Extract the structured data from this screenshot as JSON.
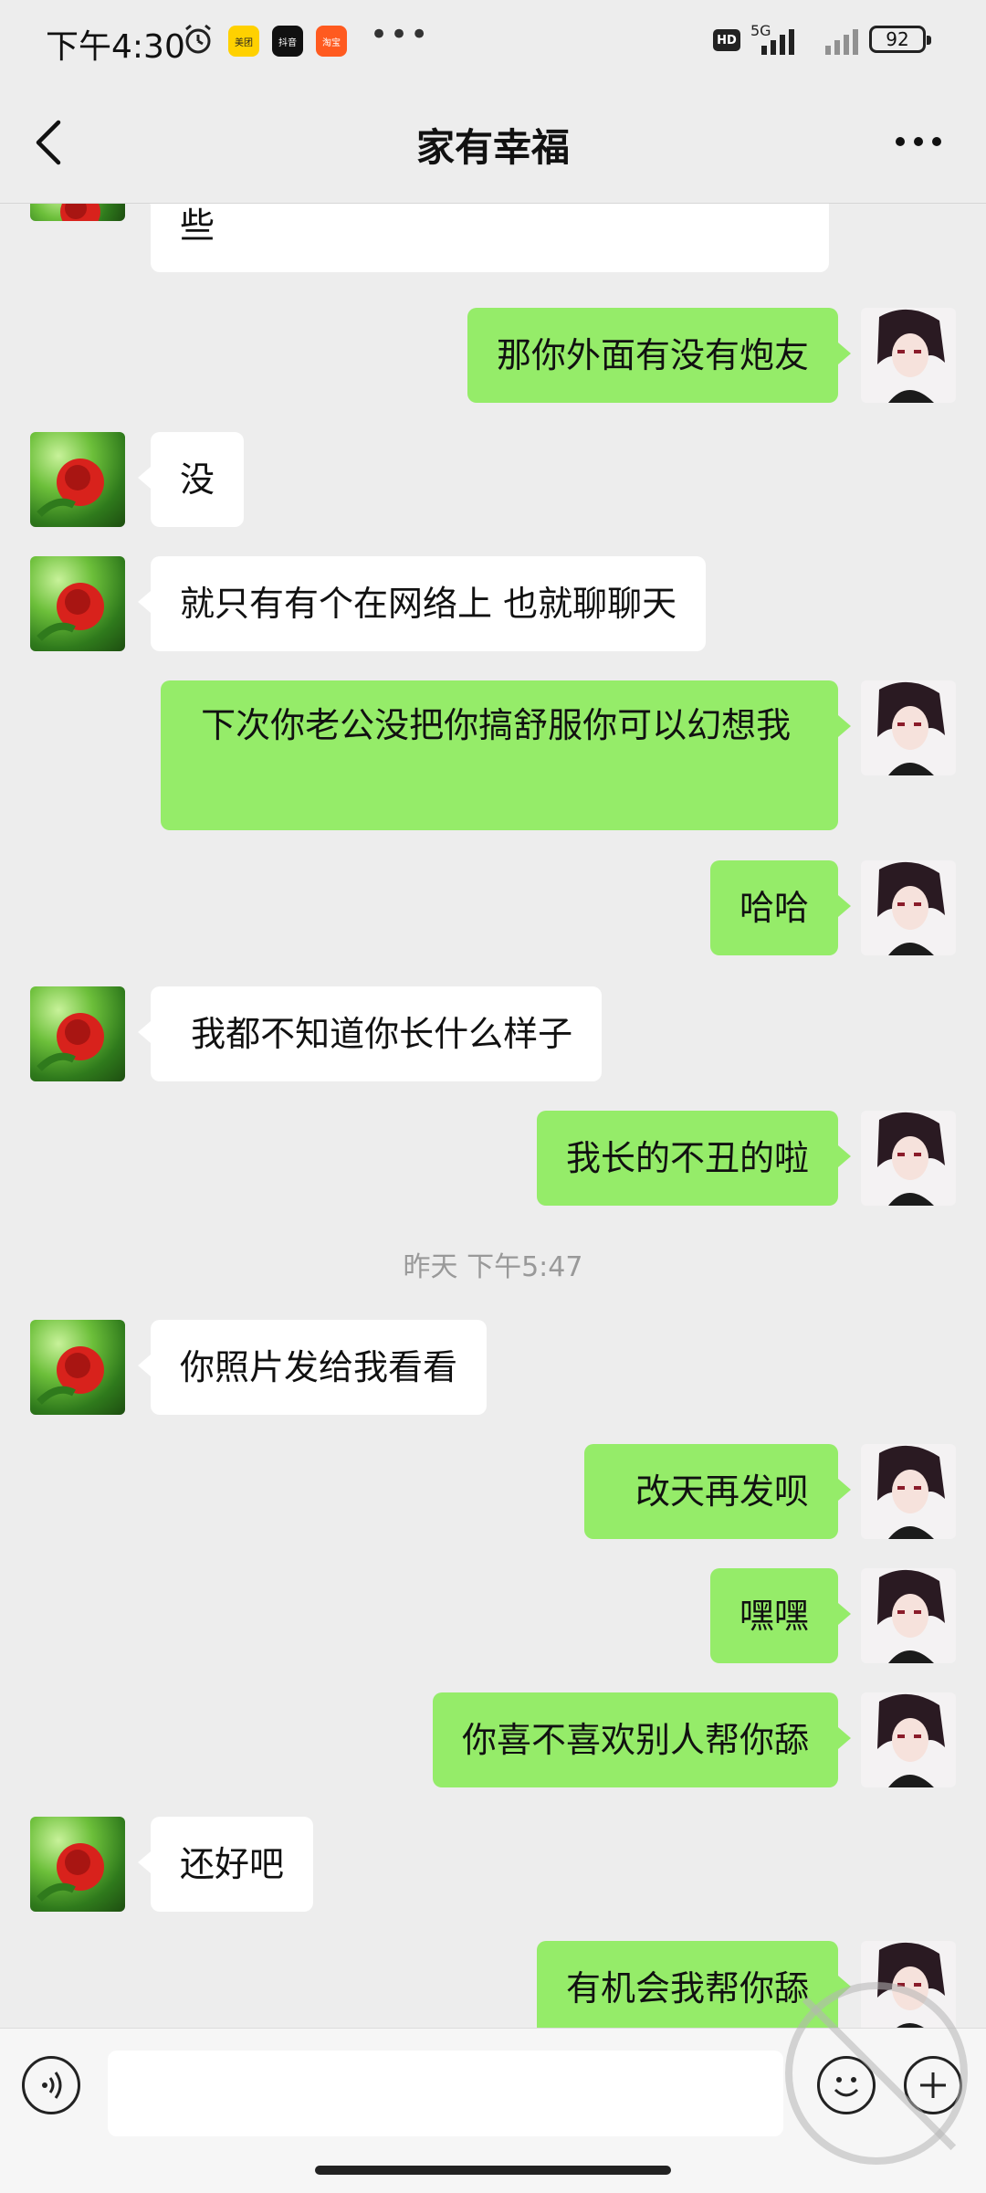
{
  "status_bar": {
    "time": "下午4:30",
    "badges": [
      "美团",
      "抖音",
      "淘宝"
    ],
    "hd": "HD",
    "network": "5G",
    "battery": "92"
  },
  "header": {
    "title": "家有幸福"
  },
  "messages": [
    {
      "side": "left",
      "text": "些"
    },
    {
      "side": "right",
      "text": "那你外面有没有炮友"
    },
    {
      "side": "left",
      "text": "没"
    },
    {
      "side": "left",
      "text": "就只有有个在网络上 也就聊聊天"
    },
    {
      "side": "right",
      "text": " 下次你老公没把你搞舒服你可以幻想我"
    },
    {
      "side": "right",
      "text": "哈哈"
    },
    {
      "side": "left",
      "text": " 我都不知道你长什么样子"
    },
    {
      "side": "right",
      "text": "我长的不丑的啦"
    },
    {
      "timestamp": "昨天 下午5:47"
    },
    {
      "side": "left",
      "text": "你照片发给我看看"
    },
    {
      "side": "right",
      "text": "  改天再发呗"
    },
    {
      "side": "right",
      "text": "嘿嘿"
    },
    {
      "side": "right",
      "text": "你喜不喜欢别人帮你舔"
    },
    {
      "side": "left",
      "text": "还好吧"
    },
    {
      "side": "right",
      "text": "有机会我帮你舔"
    }
  ],
  "input": {
    "value": ""
  },
  "icons": {
    "back": "back-arrow-icon",
    "more": "more-dots-icon",
    "voice": "voice-icon",
    "emoji": "emoji-icon",
    "plus": "plus-icon"
  },
  "colors": {
    "sent_bubble": "#95ec69",
    "received_bubble": "#ffffff",
    "background": "#ededed"
  }
}
